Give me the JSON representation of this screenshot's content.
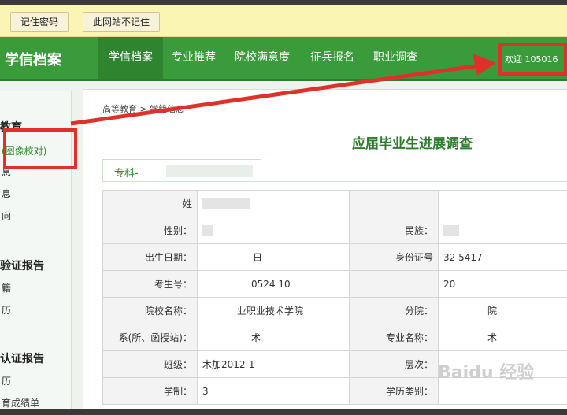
{
  "password_bar": {
    "remember_label": "记住密码",
    "never_label": "此网站不记住"
  },
  "header": {
    "brand": "学信档案",
    "nav": [
      "学信档案",
      "专业推荐",
      "院校满意度",
      "征兵报名",
      "职业调查"
    ],
    "welcome": "欢迎 105016"
  },
  "sidebar": {
    "head1": "教育",
    "items1": [
      "(图像校对)",
      "息",
      "息",
      "向"
    ],
    "head2": "验证报告",
    "items2": [
      "籍",
      "历"
    ],
    "head3": "认证报告",
    "items3": [
      "历",
      "育成绩单"
    ]
  },
  "breadcrumb": {
    "part1": "高等教育",
    "sep": ">",
    "part2": "学籍信息"
  },
  "page_title": "应届毕业生进展调查",
  "tab_label": "专科-",
  "table": {
    "rows": [
      {
        "l1": "姓",
        "v1": "",
        "l2": "",
        "v2": ""
      },
      {
        "l1": "性别：",
        "v1": "",
        "l2": "民族：",
        "v2": ""
      },
      {
        "l1": "出生日期：",
        "v1": "日",
        "l2": "身份证号",
        "v2": "32  5417"
      },
      {
        "l1": "考生号：",
        "v1": "0524 10",
        "l2": "",
        "v2": "20"
      },
      {
        "l1": "院校名称：",
        "v1": "业职业技术学院",
        "l2": "分院：",
        "v2": "院"
      },
      {
        "l1": "系(所、函授站)：",
        "v1": "术",
        "l2": "专业名称：",
        "v2": "术"
      },
      {
        "l1": "班级：",
        "v1": "木加2012-1",
        "l2": "层次：",
        "v2": ""
      },
      {
        "l1": "学制：",
        "v1": "3",
        "l2": "学历类别：",
        "v2": ""
      }
    ]
  },
  "watermark": "Baidu 经验",
  "colors": {
    "nav_green": "#3a9b3a",
    "title_green": "#2e7d2e",
    "highlight_red": "#e0302a",
    "password_bar": "#fbf5b4"
  }
}
